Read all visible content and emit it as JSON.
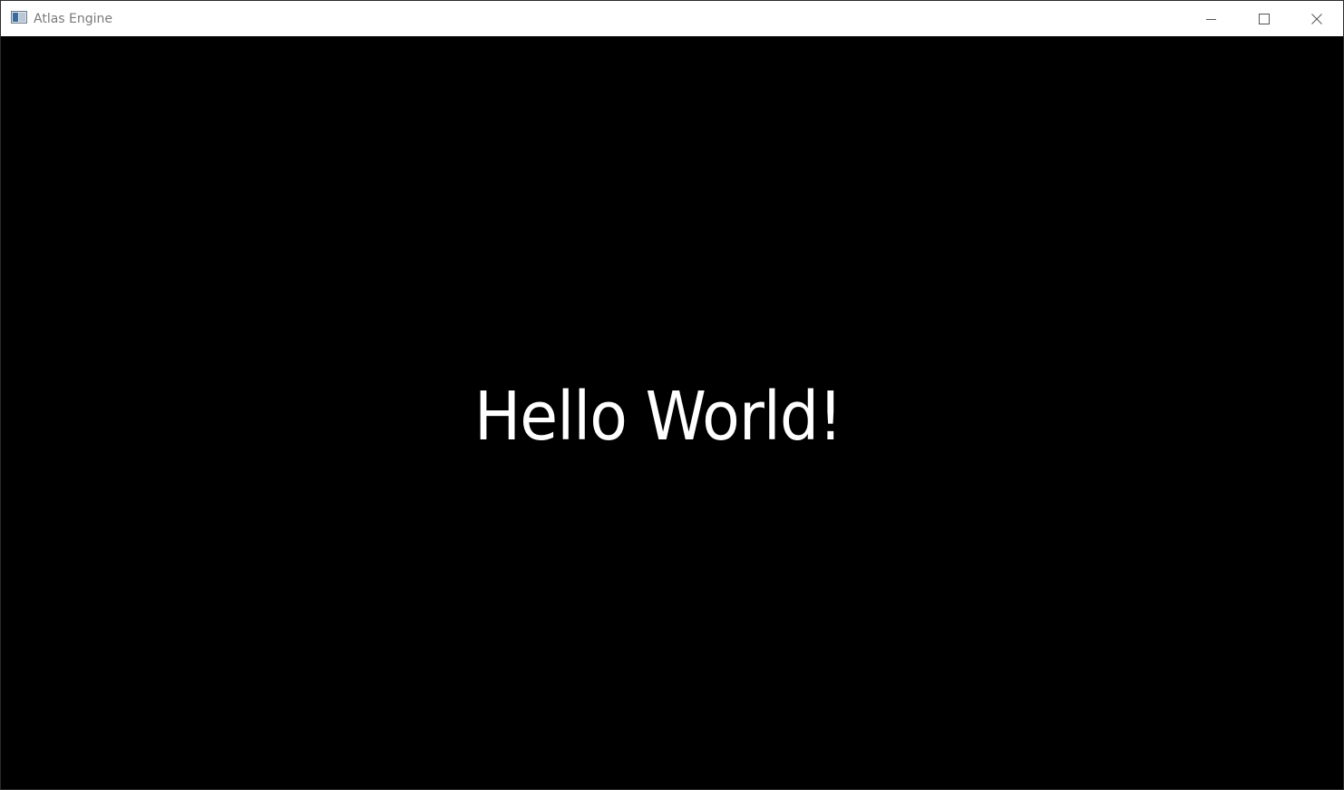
{
  "window": {
    "title": "Atlas Engine",
    "app_icon": "window-app-icon",
    "controls": {
      "minimize_icon": "minimize-icon",
      "maximize_icon": "maximize-icon",
      "close_icon": "close-icon"
    }
  },
  "content": {
    "text": "Hello World!",
    "text_color": "#ffffff",
    "background_color": "#000000"
  }
}
